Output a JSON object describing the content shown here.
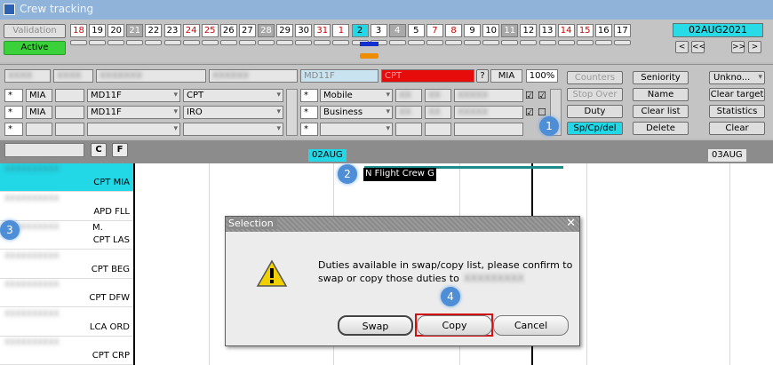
{
  "window": {
    "title": "Crew tracking"
  },
  "toolbar": {
    "validation_label": "Validation",
    "active_label": "Active",
    "days": [
      {
        "n": "18",
        "c": "red"
      },
      {
        "n": "19",
        "c": ""
      },
      {
        "n": "20",
        "c": ""
      },
      {
        "n": "21",
        "c": "gray"
      },
      {
        "n": "22",
        "c": ""
      },
      {
        "n": "23",
        "c": ""
      },
      {
        "n": "24",
        "c": "red"
      },
      {
        "n": "25",
        "c": "red"
      },
      {
        "n": "26",
        "c": ""
      },
      {
        "n": "27",
        "c": ""
      },
      {
        "n": "28",
        "c": "gray"
      },
      {
        "n": "29",
        "c": ""
      },
      {
        "n": "30",
        "c": ""
      },
      {
        "n": "31",
        "c": "red"
      },
      {
        "n": "1",
        "c": "red"
      },
      {
        "n": "2",
        "c": "sel"
      },
      {
        "n": "3",
        "c": ""
      },
      {
        "n": "4",
        "c": "gray"
      },
      {
        "n": "5",
        "c": ""
      },
      {
        "n": "7",
        "c": "red"
      },
      {
        "n": "8",
        "c": "red"
      },
      {
        "n": "9",
        "c": ""
      },
      {
        "n": "10",
        "c": ""
      },
      {
        "n": "11",
        "c": "gray"
      },
      {
        "n": "12",
        "c": ""
      },
      {
        "n": "13",
        "c": ""
      },
      {
        "n": "14",
        "c": "red"
      },
      {
        "n": "15",
        "c": "red"
      },
      {
        "n": "16",
        "c": ""
      },
      {
        "n": "17",
        "c": ""
      }
    ],
    "date": "02AUG2021",
    "nav": [
      "<",
      "<<",
      ">>",
      ">"
    ]
  },
  "panel": {
    "header": {
      "aircraft": "MD11F",
      "rank": "CPT",
      "help": "?",
      "base": "MIA",
      "zoom": "100%"
    },
    "rows": [
      {
        "base": "MIA",
        "aircraft": "MD11F",
        "rank": "CPT",
        "type": "Mobile"
      },
      {
        "base": "MIA",
        "aircraft": "MD11F",
        "rank": "IRO",
        "type": "Business"
      }
    ],
    "buttons_col1": [
      "Counters",
      "Stop Over",
      "Duty",
      "Sp/Cp/del"
    ],
    "buttons_col2": [
      "Seniority",
      "Name",
      "Clear list",
      "Delete"
    ],
    "buttons_col3": [
      "Unkno...",
      "Clear target",
      "Statistics",
      "Clear"
    ]
  },
  "gridhead": {
    "c": "C",
    "f": "F",
    "date1": "02AUG",
    "date2": "03AUG"
  },
  "tooltip": "N Flight Crew G",
  "crew": [
    {
      "sub": "CPT MIA"
    },
    {
      "sub": "APD FLL"
    },
    {
      "sub": "CPT LAS",
      "mid": "M."
    },
    {
      "sub": "CPT BEG"
    },
    {
      "sub": "CPT DFW"
    },
    {
      "sub": "LCA ORD"
    },
    {
      "sub": "CPT CRP"
    }
  ],
  "dialog": {
    "title": "Selection",
    "message_line1": "Duties available in swap/copy list, please confirm to",
    "message_line2": "swap or copy those duties to",
    "swap": "Swap",
    "copy": "Copy",
    "cancel": "Cancel"
  },
  "markers": [
    "1",
    "2",
    "3",
    "4"
  ],
  "colors": {
    "accent": "#22d7e6",
    "active": "#3bd13b",
    "warning": "#f0d000",
    "marker": "#4d8ed6",
    "highlight": "#d01010"
  }
}
